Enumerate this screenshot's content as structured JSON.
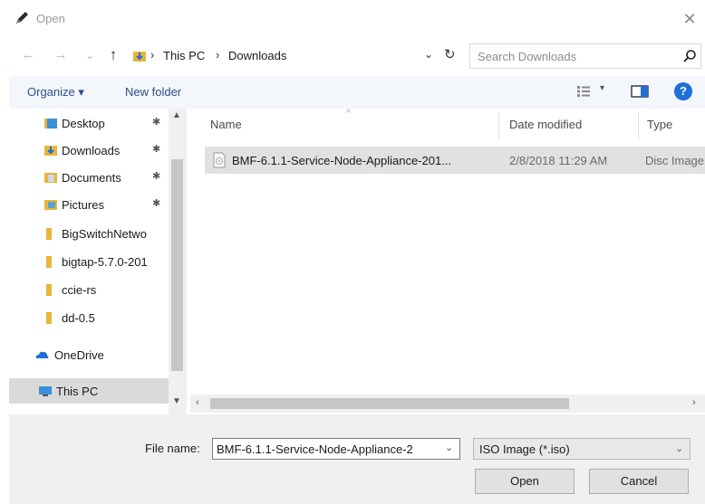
{
  "window": {
    "title": "Open",
    "close_glyph": "✕",
    "title_icon": "pencil-icon"
  },
  "nav": {
    "back_glyph": "←",
    "forward_glyph": "→",
    "recent_glyph": "⌄",
    "up_glyph": "↑",
    "breadcrumb": [
      "This PC",
      "Downloads"
    ],
    "separator": "›",
    "dropdown_glyph": "⌄",
    "refresh_glyph": "↻"
  },
  "search": {
    "placeholder": "Search Downloads"
  },
  "toolbar": {
    "organize_label": "Organize ▾",
    "new_folder_label": "New folder",
    "view_dropdown_glyph": "▾",
    "help_glyph": "?"
  },
  "sidebar": {
    "items": [
      {
        "label": "Desktop",
        "pinned": true,
        "icon": "desktop-folder-icon",
        "color": "#3a8fd9"
      },
      {
        "label": "Downloads",
        "pinned": true,
        "icon": "downloads-folder-icon",
        "color": "#3a8fd9"
      },
      {
        "label": "Documents",
        "pinned": true,
        "icon": "documents-folder-icon",
        "color": "#8aa9c9"
      },
      {
        "label": "Pictures",
        "pinned": true,
        "icon": "pictures-folder-icon",
        "color": "#5aa0d0"
      },
      {
        "label": "BigSwitchNetwo",
        "pinned": false,
        "icon": "folder-icon",
        "color": "#e8b53a"
      },
      {
        "label": "bigtap-5.7.0-201",
        "pinned": false,
        "icon": "folder-icon",
        "color": "#e8b53a"
      },
      {
        "label": "ccie-rs",
        "pinned": false,
        "icon": "folder-icon",
        "color": "#e8b53a"
      },
      {
        "label": "dd-0.5",
        "pinned": false,
        "icon": "folder-icon",
        "color": "#e8b53a"
      },
      {
        "label": "OneDrive",
        "pinned": false,
        "icon": "onedrive-icon",
        "color": "#1f6fd6"
      },
      {
        "label": "This PC",
        "pinned": false,
        "icon": "this-pc-icon",
        "color": "#3a8fd9",
        "selected": true
      }
    ],
    "pin_glyph": "📌",
    "scroll_up_glyph": "▲",
    "scroll_down_glyph": "▼"
  },
  "files": {
    "columns": [
      "Name",
      "Date modified",
      "Type"
    ],
    "sort_glyph": "^",
    "rows": [
      {
        "name": "BMF-6.1.1-Service-Node-Appliance-201...",
        "date": "2/8/2018 11:29 AM",
        "type": "Disc Image",
        "icon": "disc-image-file-icon"
      }
    ],
    "hscroll_left_glyph": "‹",
    "hscroll_right_glyph": "›"
  },
  "footer": {
    "file_name_label": "File name:",
    "file_name_value": "BMF-6.1.1-Service-Node-Appliance-2",
    "file_name_drop_glyph": "⌄",
    "file_type_value": "ISO Image (*.iso)",
    "file_type_drop_glyph": "⌄",
    "open_label": "Open",
    "cancel_label": "Cancel"
  },
  "colors": {
    "accent": "#1f6fd6",
    "link": "#2a4f86",
    "folder": "#e8b53a",
    "selection": "#dadada"
  }
}
